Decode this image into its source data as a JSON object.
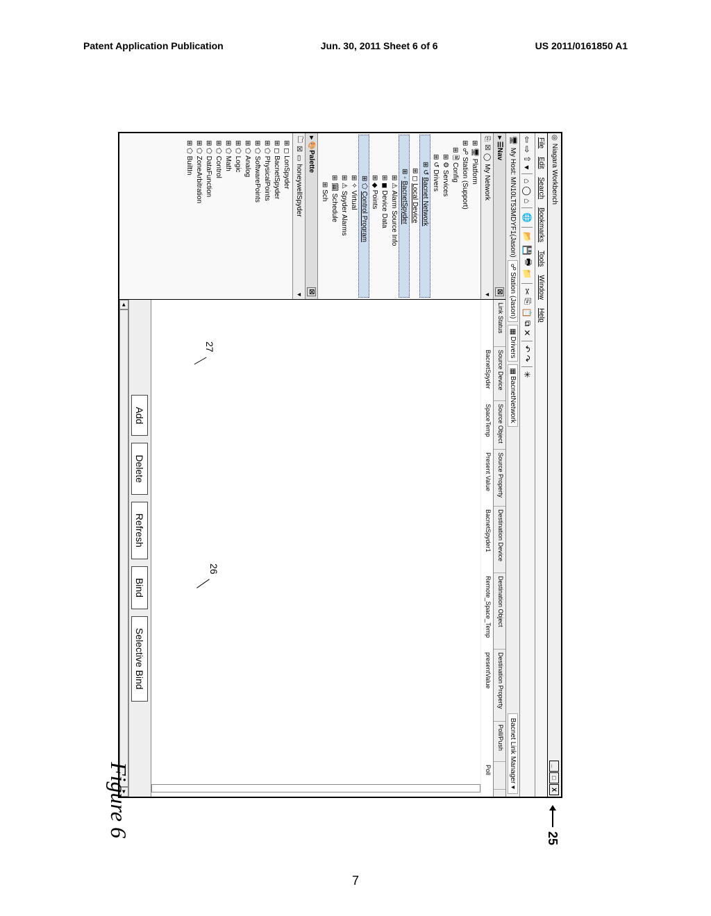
{
  "pub": {
    "left": "Patent Application Publication",
    "center": "Jun. 30, 2011  Sheet 6 of 6",
    "right": "US 2011/0161850 A1"
  },
  "refs": {
    "r25": "25",
    "r26": "26",
    "r27": "27"
  },
  "figure_label": "Figure 6",
  "page_number": "7",
  "app": {
    "title": "Niagara Workbench",
    "menus": [
      "File",
      "Edit",
      "Search",
      "Bookmarks",
      "Tools",
      "Window",
      "Help"
    ],
    "address": {
      "host": "My Host: MN10LT53MDYF1(Jason)",
      "station": "Station (Jason)",
      "drivers": "Drivers",
      "network": "BacnetNetwork",
      "manager": "Bacnet Link Manager"
    },
    "nav": {
      "title": "Nav",
      "root": "My Network",
      "items": [
        {
          "l": 1,
          "t": "Platform"
        },
        {
          "l": 1,
          "t": "Station (Support)"
        },
        {
          "l": 2,
          "t": "Config"
        },
        {
          "l": 3,
          "t": "Services"
        },
        {
          "l": 3,
          "t": "Drivers"
        },
        {
          "l": 4,
          "t": "Bacnet Network"
        },
        {
          "l": 5,
          "t": "Local Device"
        },
        {
          "l": 5,
          "t": "BacnetSpyder",
          "sel": true
        },
        {
          "l": 6,
          "t": "Alarm Source Info"
        },
        {
          "l": 6,
          "t": "Device Data"
        },
        {
          "l": 6,
          "t": "Points"
        },
        {
          "l": 6,
          "t": "Control Program",
          "sel": true
        },
        {
          "l": 6,
          "t": "Virtual"
        },
        {
          "l": 6,
          "t": "Spyder Alarms"
        },
        {
          "l": 6,
          "t": "Schedule"
        },
        {
          "l": 6,
          "t": "Sch"
        }
      ]
    },
    "palette": {
      "title": "Palette",
      "device": "honeywellSpyder",
      "items": [
        "LonSpyder",
        "BacnetSpyder",
        "PhysicalPoints",
        "SoftwarePoints",
        "Analog",
        "Logic",
        "Math",
        "Control",
        "DataFunction",
        "ZoneArbitration",
        "BuiltIn"
      ]
    },
    "grid": {
      "headers": [
        "Link Status",
        "Source Device",
        "Source Object",
        "Source Property",
        "Destination Device",
        "Destination Object",
        "Destination Property",
        "Poll/Push",
        ""
      ],
      "row": [
        "",
        "BacnetSpyder",
        "SpaceTemp",
        "Present Value",
        "BacnetSpyder1",
        "Remote_Space_Temp",
        "presentValue",
        "",
        "Poll"
      ]
    },
    "buttons": {
      "add": "Add",
      "delete": "Delete",
      "refresh": "Refresh",
      "bind": "Bind",
      "selective": "Selective Bind"
    }
  }
}
